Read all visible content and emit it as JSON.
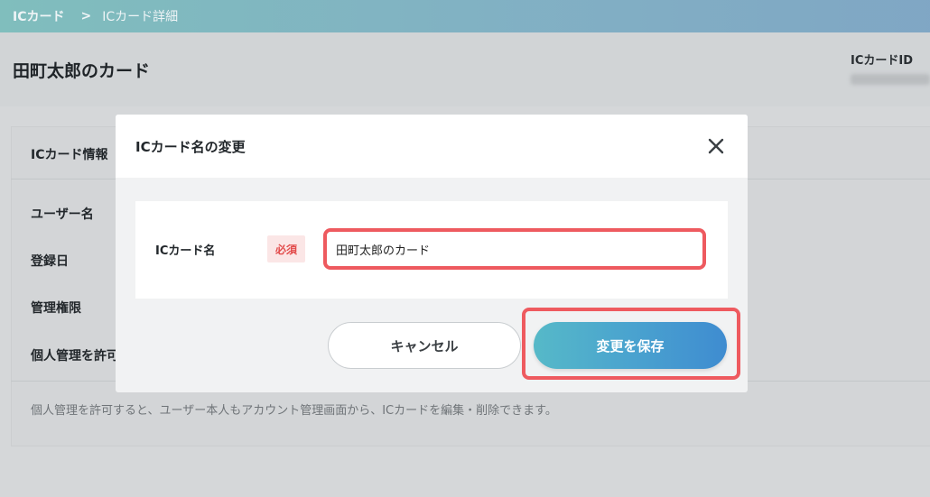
{
  "breadcrumb": {
    "root": "ICカード",
    "separator": ">",
    "current": "ICカード詳細"
  },
  "page": {
    "title": "田町太郎のカード",
    "id_label": "ICカードID"
  },
  "card": {
    "title": "ICカード情報",
    "rows": [
      {
        "label": "ユーザー名"
      },
      {
        "label": "登録日"
      },
      {
        "label": "管理権限"
      },
      {
        "label": "個人管理を許可"
      }
    ],
    "note": "個人管理を許可すると、ユーザー本人もアカウント管理画面から、ICカードを編集・削除できます。"
  },
  "modal": {
    "title": "ICカード名の変更",
    "field_label": "ICカード名",
    "required_badge": "必須",
    "input_value": "田町太郎のカード",
    "cancel_label": "キャンセル",
    "save_label": "変更を保存"
  },
  "colors": {
    "highlight": "#ee5a5f",
    "primary_gradient_start": "#56b9c8",
    "primary_gradient_end": "#3f8cd0",
    "required": "#e24a4a"
  },
  "icons": {
    "close": "close-icon"
  }
}
